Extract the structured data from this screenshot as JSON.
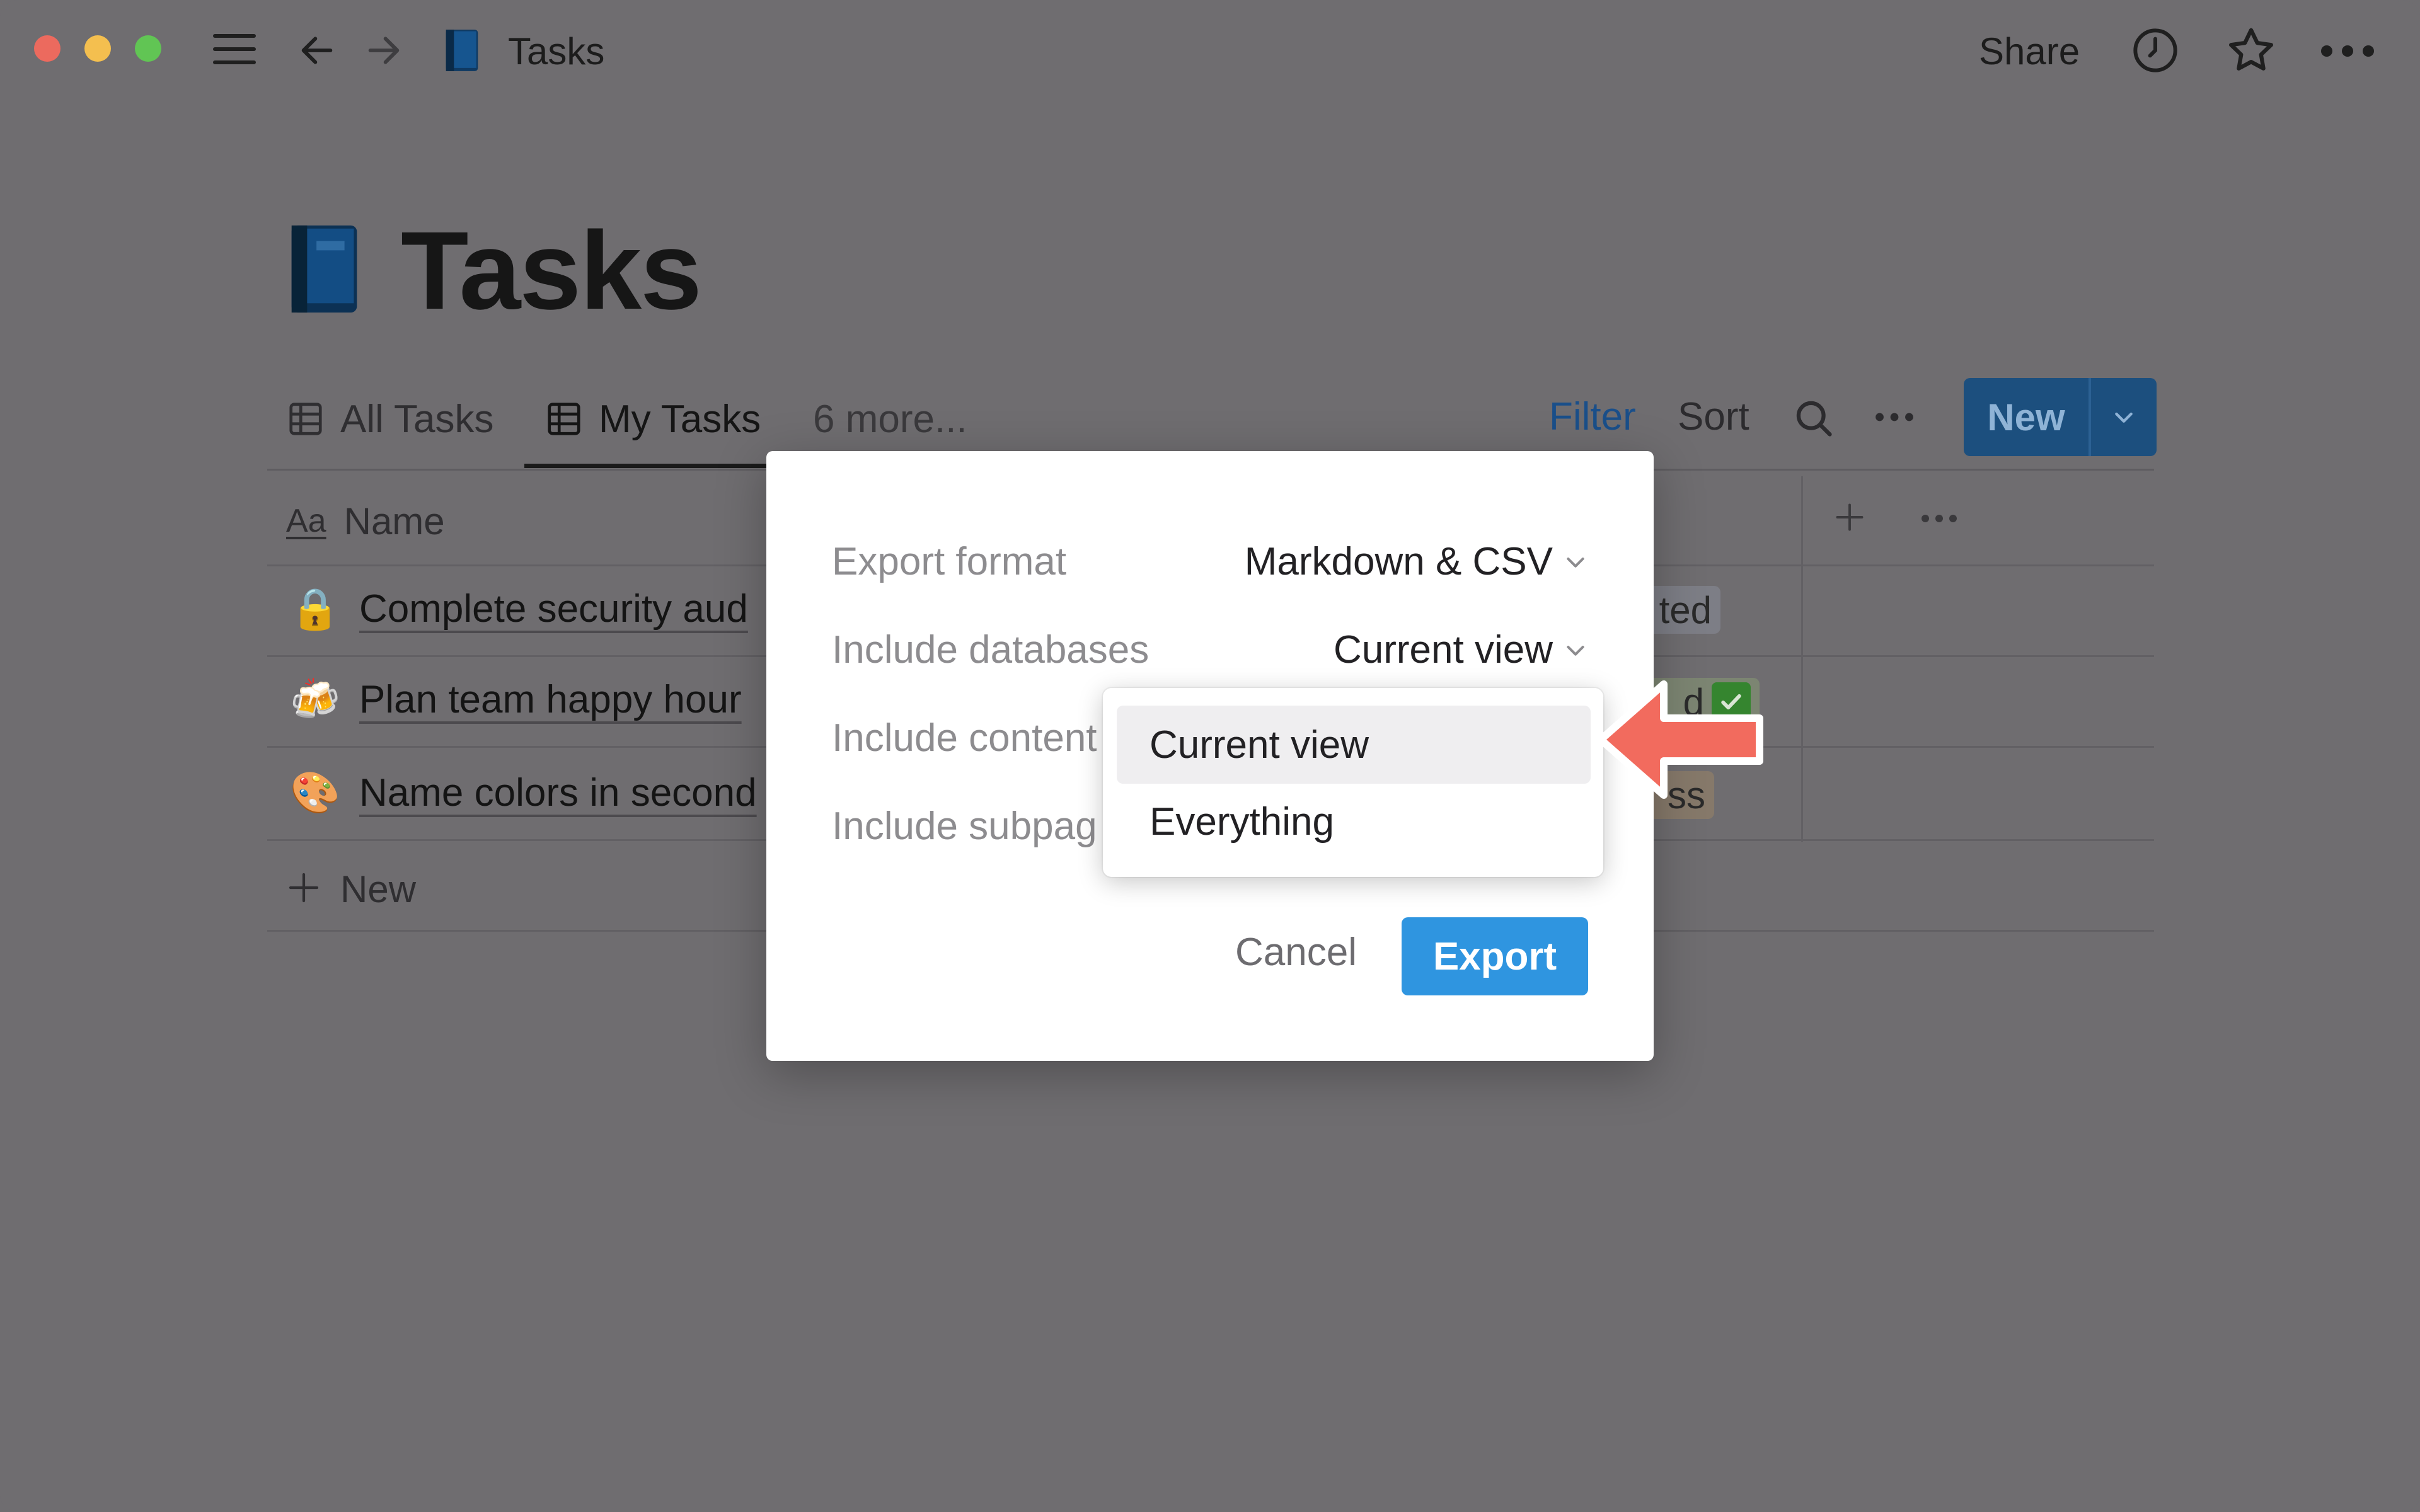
{
  "window": {
    "breadcrumb_title": "Tasks"
  },
  "topbar": {
    "share_label": "Share"
  },
  "page": {
    "title": "Tasks"
  },
  "views": {
    "tabs": [
      {
        "label": "All Tasks"
      },
      {
        "label": "My Tasks",
        "active": true
      }
    ],
    "more_label": "6 more...",
    "filter_label": "Filter",
    "sort_label": "Sort",
    "new_label": "New"
  },
  "table": {
    "name_icon": "Aa",
    "name_header": "Name",
    "rows": [
      {
        "emoji": "🔒",
        "name": "Complete security aud",
        "status_fragment": "ted"
      },
      {
        "emoji": "🍻",
        "name": "Plan team happy hour",
        "status_fragment": "d"
      },
      {
        "emoji": "🎨",
        "name": "Name colors in second",
        "status_fragment": "ss"
      }
    ],
    "new_row_label": "New"
  },
  "export_dialog": {
    "options": [
      {
        "label": "Export format",
        "value": "Markdown & CSV"
      },
      {
        "label": "Include databases",
        "value": "Current view"
      },
      {
        "label": "Include content"
      },
      {
        "label": "Include subpag"
      }
    ],
    "cancel_label": "Cancel",
    "export_label": "Export"
  },
  "databases_dropdown": {
    "options": [
      "Current view",
      "Everything"
    ],
    "selected": "Current view"
  },
  "colors": {
    "accent_blue": "#2f95e0",
    "overlay_bg": "#6f6d70",
    "callout_arrow": "#f26b5e"
  }
}
